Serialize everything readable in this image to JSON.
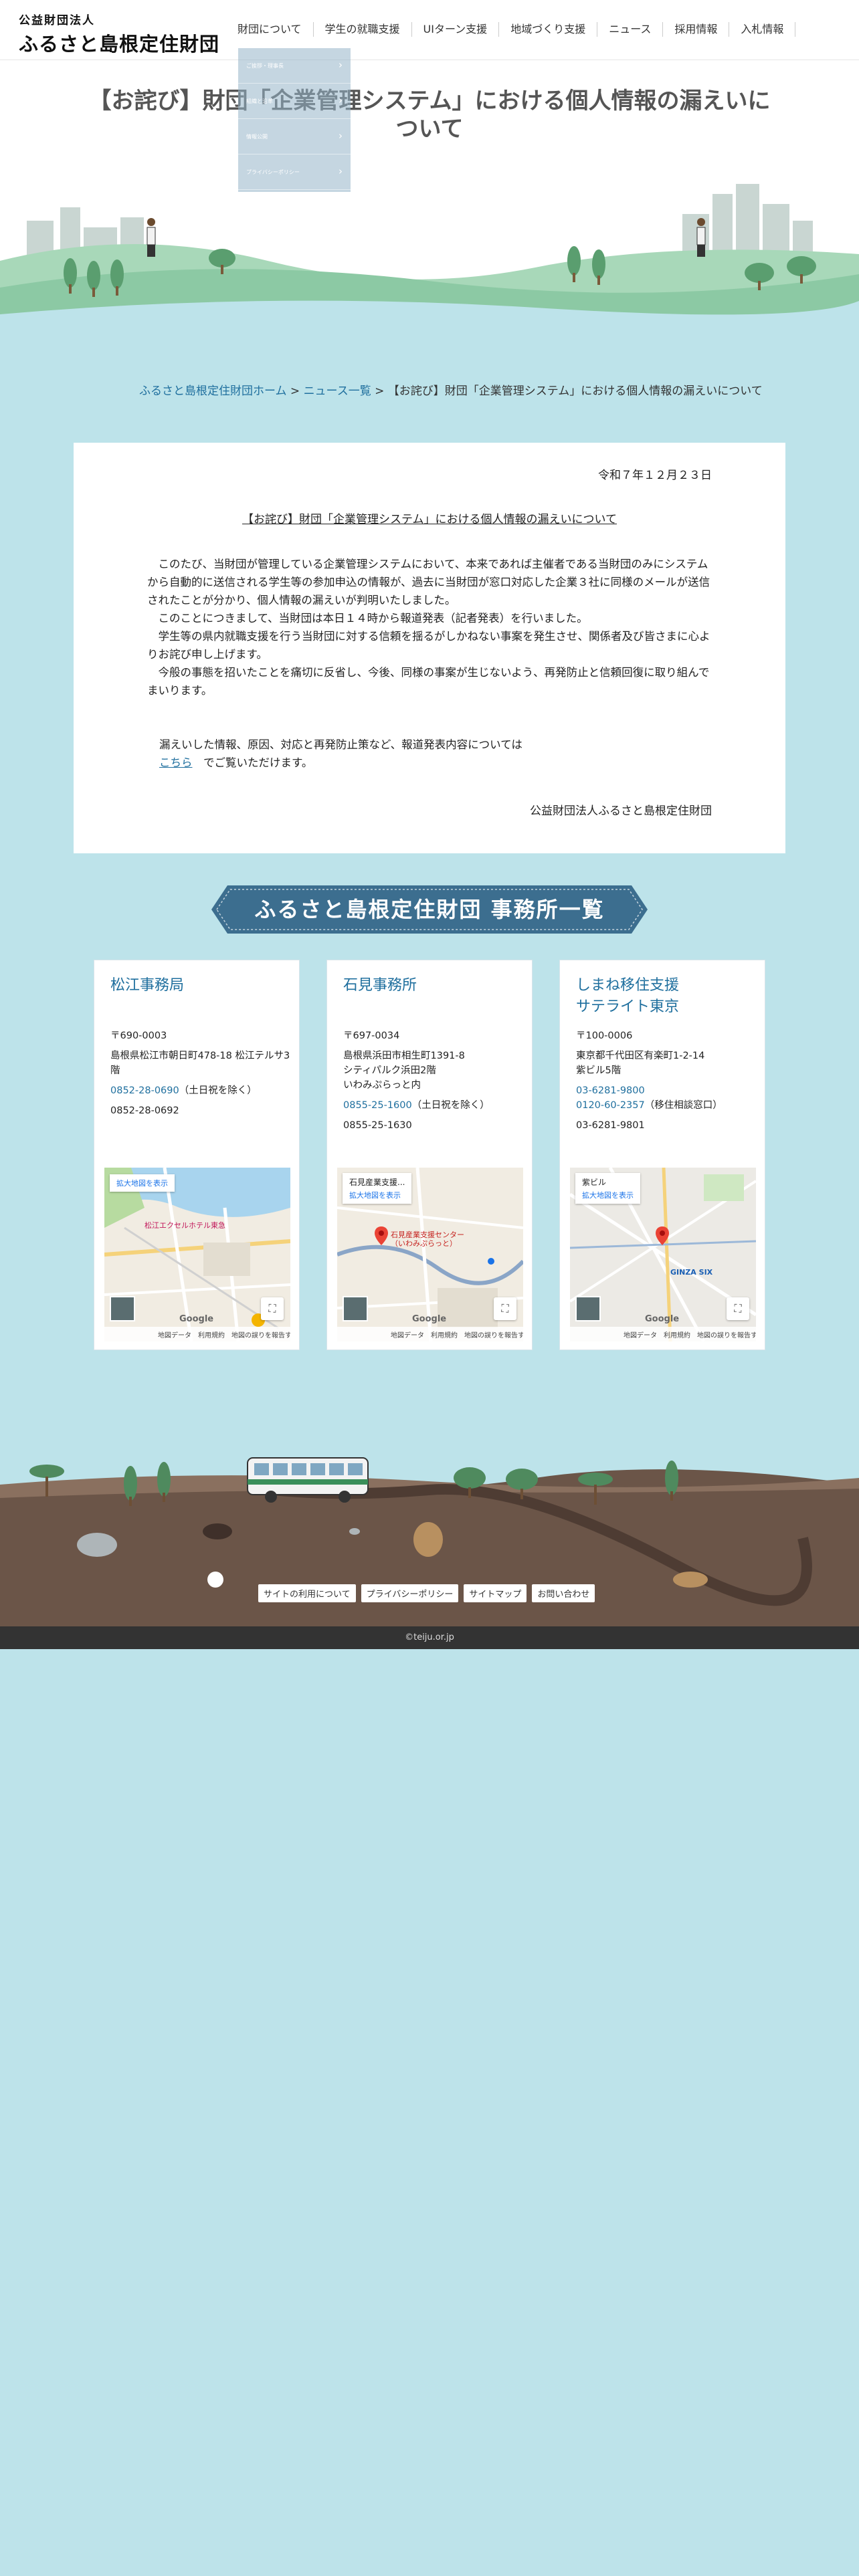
{
  "header": {
    "logo_small": "公益財団法人",
    "logo_big": "ふるさと島根定住財団",
    "nav": [
      "財団について",
      "学生の就職支援",
      "UIターン支援",
      "地域づくり支援",
      "ニュース",
      "採用情報",
      "入札情報"
    ]
  },
  "dropdown": {
    "items": [
      "ご挨拶・理事長",
      "組織と沿革",
      "情報公開",
      "プライバシーポリシー"
    ]
  },
  "hero": {
    "title": "【お詫び】財団「企業管理システム」における個人情報の漏えいについて"
  },
  "breadcrumb": {
    "home": "ふるさと島根定住財団ホーム",
    "sep": " > ",
    "list": "ニュース一覧",
    "current": "【お詫び】財団「企業管理システム」における個人情報の漏えいについて"
  },
  "article": {
    "date": "令和７年１２月２３日",
    "subject": "【お詫び】財団「企業管理システム」における個人情報の漏えいについて",
    "para1": "　このたび、当財団が管理している企業管理システムにおいて、本来であれば主催者である当財団のみにシステムから自動的に送信される学生等の参加申込の情報が、過去に当財団が窓口対応した企業３社に同様のメールが送信されたことが分かり、個人情報の漏えいが判明いたしました。",
    "para2": "　このことにつきまして、当財団は本日１４時から報道発表（記者発表）を行いました。",
    "para3": "　学生等の県内就職支援を行う当財団に対する信頼を揺るがしかねない事案を発生させ、関係者及び皆さまに心よりお詫び申し上げます。",
    "para4": "　今般の事態を招いたことを痛切に反省し、今後、同様の事案が生じないよう、再発防止と信頼回復に取り組んでまいります。",
    "link_intro": "漏えいした情報、原因、対応と再発防止策など、報道発表内容については",
    "link_text": "こちら",
    "link_outro": "　でご覧いただけます。",
    "signature": "公益財団法人ふるさと島根定住財団"
  },
  "offices_title": "ふるさと島根定住財団 事務所一覧",
  "offices": [
    {
      "name": "松江事務局",
      "zip": "〒690-0003",
      "address": "島根県松江市朝日町478-18 松江テルサ3階",
      "tel": "0852-28-0690",
      "tel_note": "（土日祝を除く）",
      "fax": "0852-28-0692",
      "map_label": "",
      "map_enlarge": "拡大地図を表示",
      "map_poi": "松江エクセルホテル東急"
    },
    {
      "name": "石見事務所",
      "zip": "〒697-0034",
      "address1": "島根県浜田市相生町1391-8",
      "address2": "シティパルク浜田2階",
      "address3": "いわみぷらっと内",
      "tel": "0855-25-1600",
      "tel_note": "（土日祝を除く）",
      "fax": "0855-25-1630",
      "map_label": "石見産業支援...",
      "map_enlarge": "拡大地図を表示",
      "map_poi": "石見産業支援センター（いわみぷらっと）"
    },
    {
      "name_line1": "しまね移住支援",
      "name_line2": "サテライト東京",
      "zip": "〒100-0006",
      "address1": "東京都千代田区有楽町1-2-14",
      "address2": "紫ビル5階",
      "tel": "03-6281-9800",
      "tel2": "0120-60-2357",
      "tel2_note": "（移住相談窓口）",
      "fax": "03-6281-9801",
      "map_label": "紫ビル",
      "map_enlarge": "拡大地図を表示",
      "map_poi": "GINZA SIX"
    }
  ],
  "map_footer": {
    "google": "Google",
    "text": "地図データ　利用規約　地図の誤りを報告する"
  },
  "footer": {
    "links": [
      "サイトの利用について",
      "プライバシーポリシー",
      "サイトマップ",
      "お問い合わせ"
    ],
    "copyright": "©teiju.or.jp"
  },
  "colors": {
    "background": "#bde3ea",
    "accent": "#1f6f9e",
    "banner": "#3c6e8f",
    "hill": "#8cc9a4",
    "ground": "#6b5548"
  }
}
